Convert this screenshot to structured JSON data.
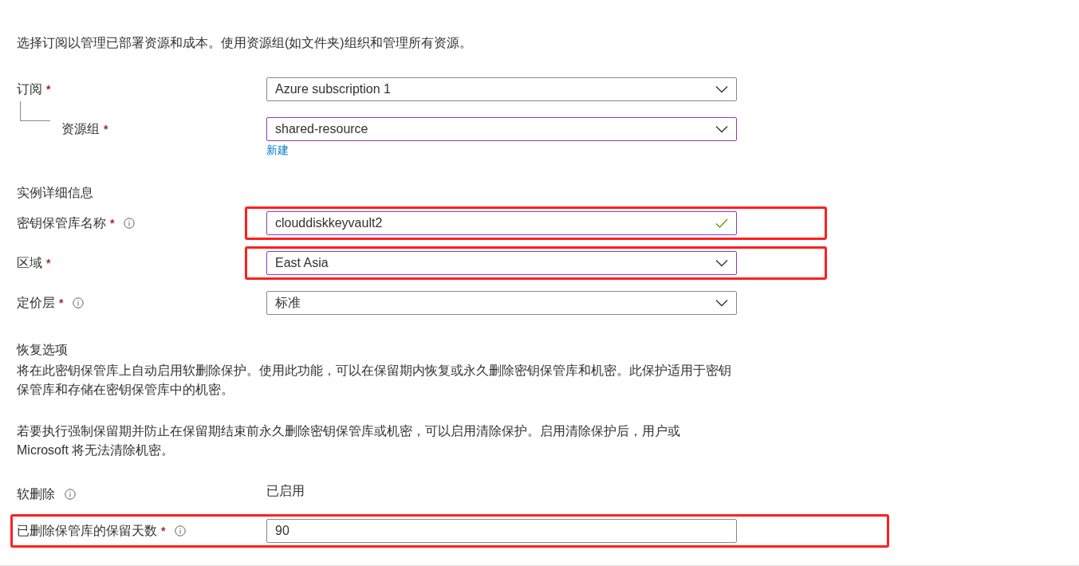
{
  "intro": "选择订阅以管理已部署资源和成本。使用资源组(如文件夹)组织和管理所有资源。",
  "project_fields": [
    {
      "label": "订阅",
      "required_mark": "*",
      "info": false,
      "kind": "dropdown",
      "value": "Azure subscription 1",
      "focused": false,
      "nested": false,
      "highlighted": false
    },
    {
      "label": "资源组",
      "required_mark": "*",
      "info": false,
      "kind": "dropdown",
      "value": "shared-resource",
      "focused": true,
      "nested": true,
      "highlighted": false,
      "link": "新建"
    }
  ],
  "instance_heading": "实例详细信息",
  "instance_fields": [
    {
      "label": "密钥保管库名称",
      "required_mark": "*",
      "info": true,
      "kind": "text",
      "value": "clouddiskkeyvault2",
      "focused": true,
      "valid": true,
      "highlighted": true
    },
    {
      "label": "区域",
      "required_mark": "*",
      "info": false,
      "kind": "dropdown",
      "value": "East Asia",
      "focused": true,
      "highlighted": true
    },
    {
      "label": "定价层",
      "required_mark": "*",
      "info": true,
      "kind": "dropdown",
      "value": "标准",
      "focused": false,
      "highlighted": false
    }
  ],
  "recovery_heading": "恢复选项",
  "paragraphs": [
    "将在此密钥保管库上自动启用软删除保护。使用此功能，可以在保留期内恢复或永久删除密钥保管库和机密。此保护适用于密钥保管库和存储在密钥保管库中的机密。",
    "若要执行强制保留期并防止在保留期结束前永久删除密钥保管库或机密，可以启用清除保护。启用清除保护后，用户或 Microsoft 将无法清除机密。"
  ],
  "recovery_fields": [
    {
      "label": "软删除",
      "info": true,
      "kind": "static",
      "value": "已启用",
      "highlighted": false
    },
    {
      "label": "已删除保管库的保留天数",
      "required_mark": "*",
      "info": true,
      "kind": "text",
      "value": "90",
      "focused": false,
      "valid": false,
      "highlighted": true
    }
  ]
}
